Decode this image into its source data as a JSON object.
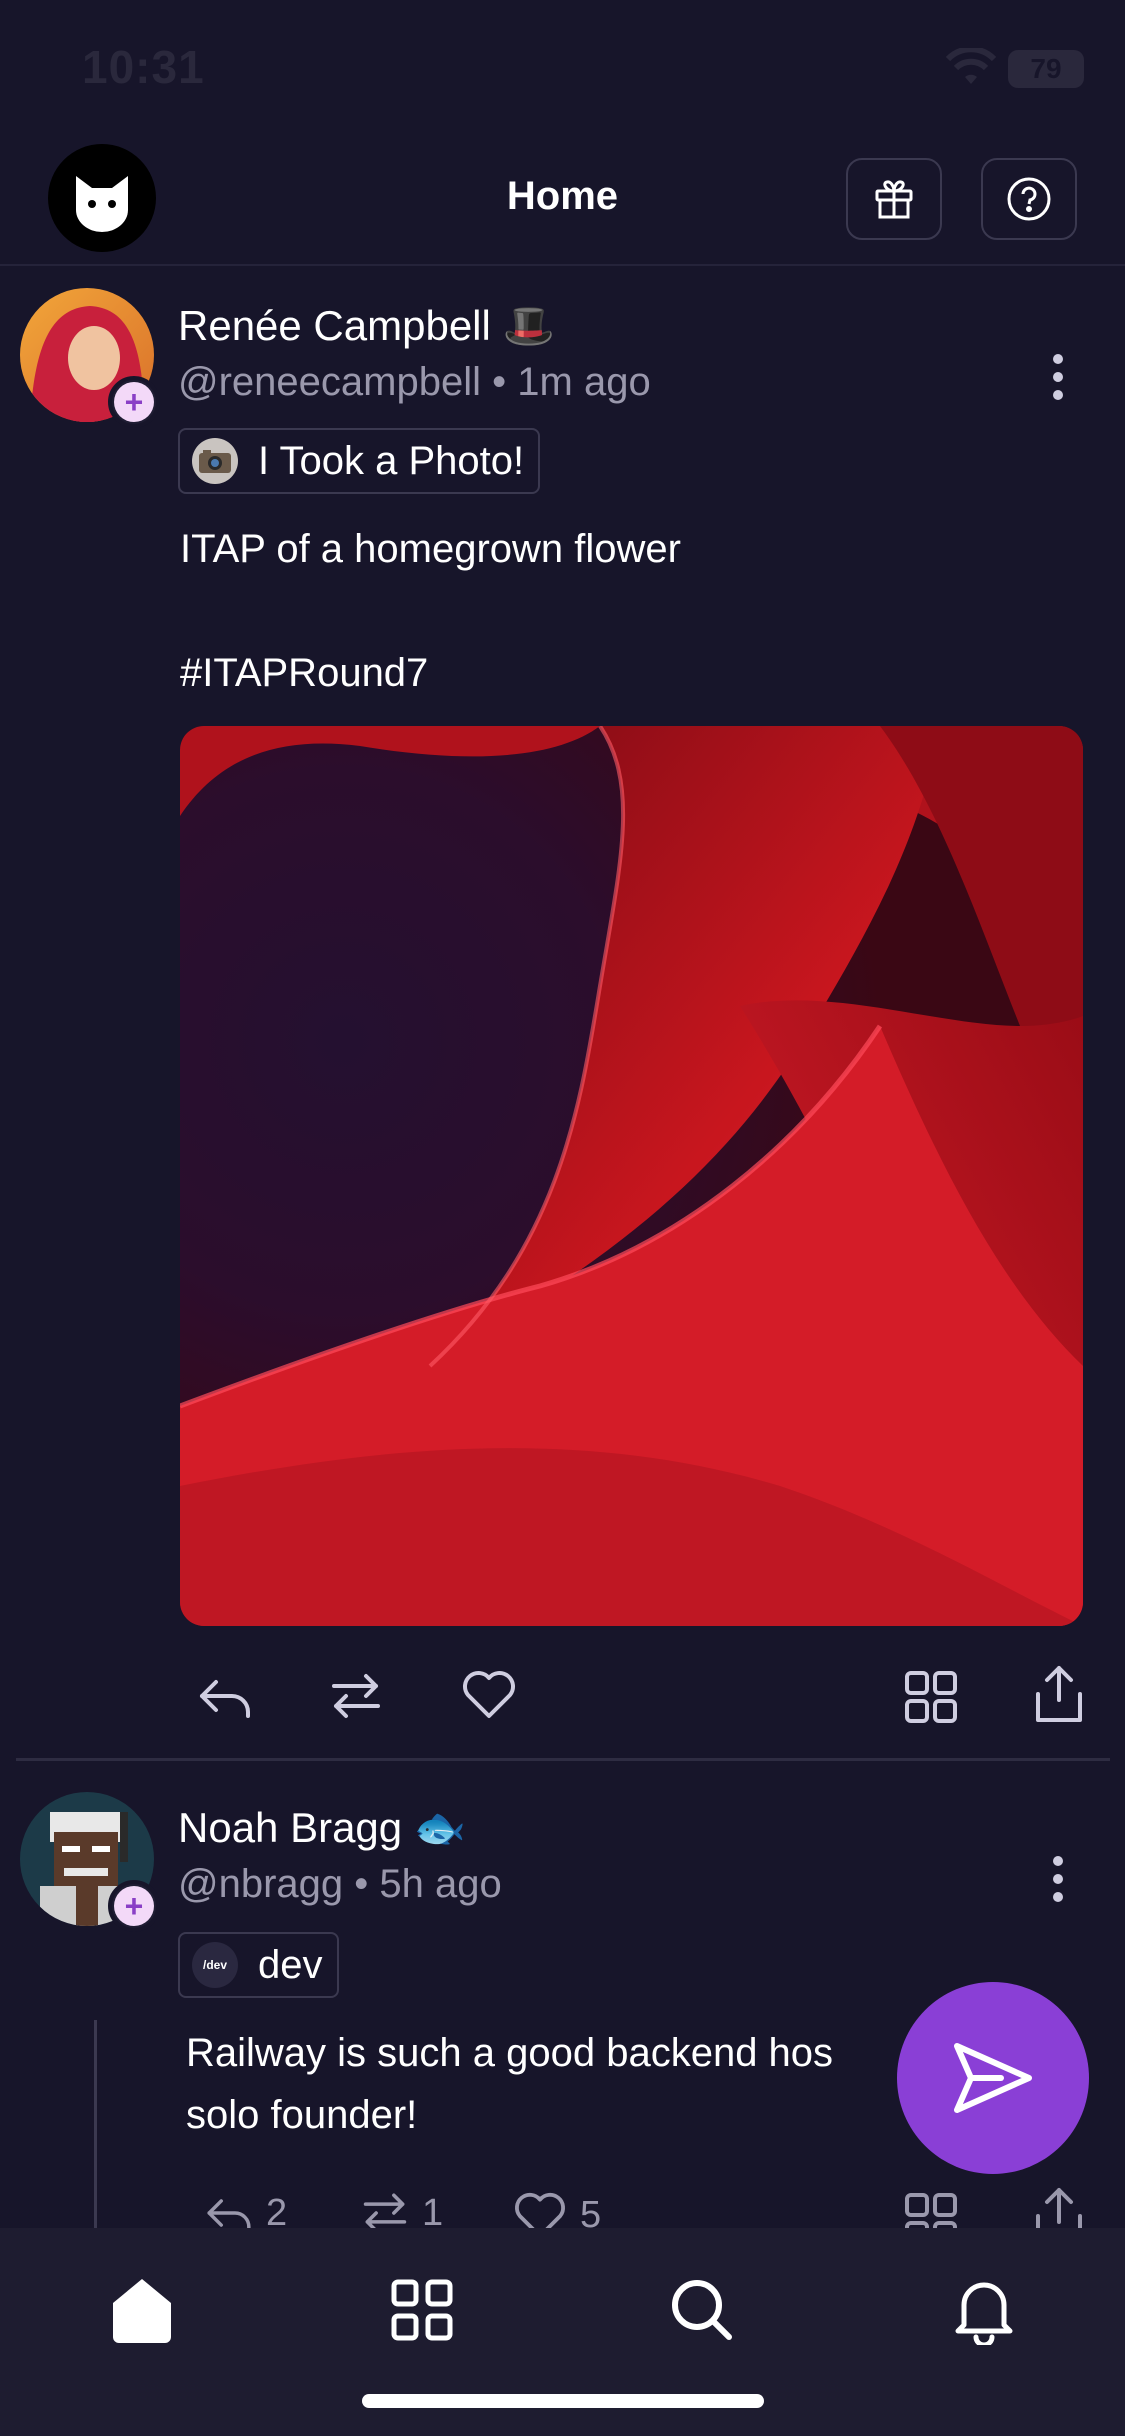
{
  "status_bar": {
    "time": "10:31",
    "battery": "79"
  },
  "header": {
    "title": "Home"
  },
  "posts": [
    {
      "author": "Renée Campbell",
      "author_emoji": "🎩",
      "handle": "@reneecampbell",
      "time_ago": "1m ago",
      "community": "I Took a Photo!",
      "text_line1": "ITAP of a homegrown flower",
      "text_line2": "#ITAPRound7"
    },
    {
      "author": "Noah Bragg",
      "author_emoji": "🐟",
      "handle": "@nbragg",
      "time_ago": "5h ago",
      "community": "dev",
      "community_icon_text": "/dev",
      "text_line1": "Railway is such a good backend hos",
      "text_line2": "solo founder!",
      "replies": "2",
      "reposts": "1",
      "likes": "5"
    }
  ],
  "separator": "•",
  "colors": {
    "accent": "#8a3fd6",
    "background": "#17152a",
    "tabbar": "#1e1c30"
  },
  "tabs": [
    "home-icon",
    "grid-icon",
    "search-icon",
    "bell-icon"
  ]
}
